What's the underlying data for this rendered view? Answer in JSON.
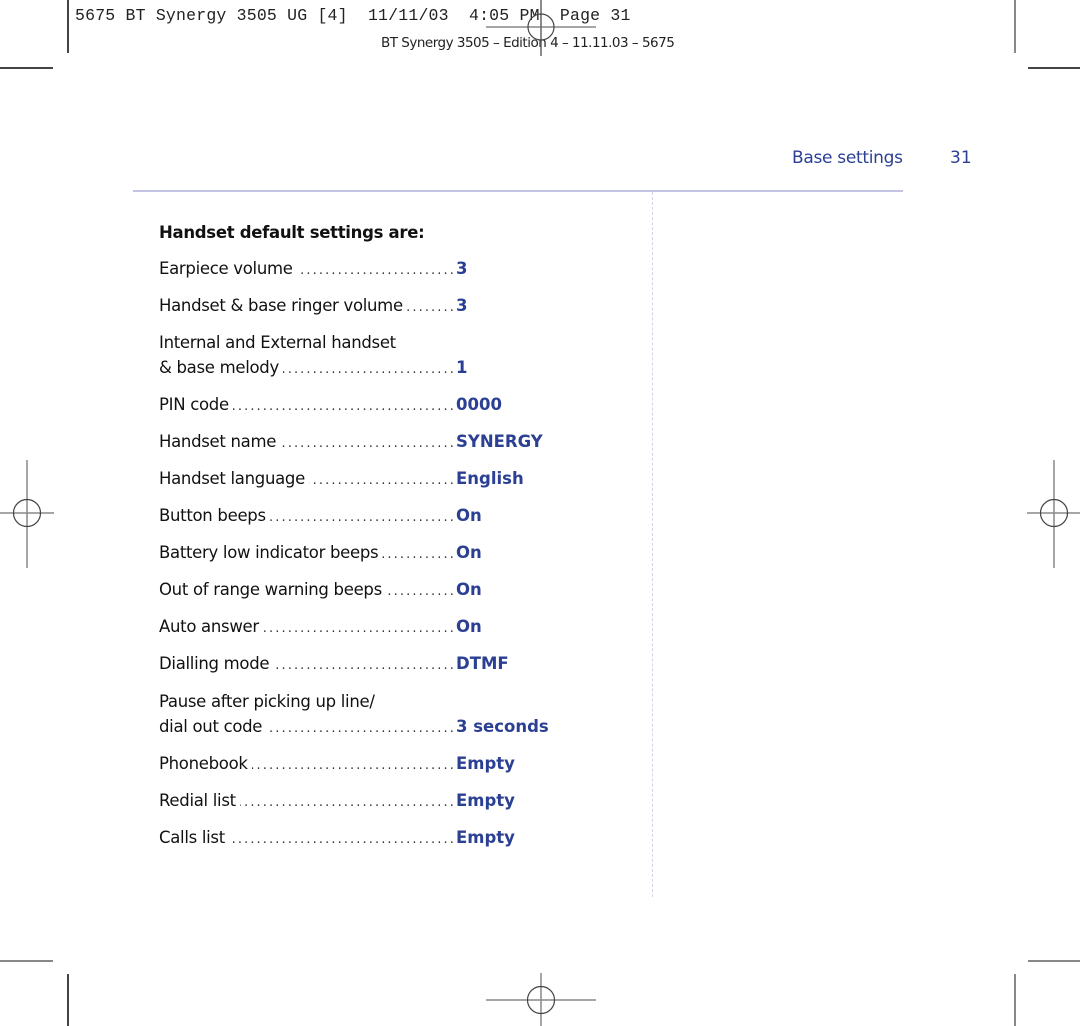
{
  "print_slug": "5675 BT Synergy 3505 UG [4]  11/11/03  4:05 PM  Page 31",
  "edition_line": "BT Synergy 3505 – Edition 4 – 11.11.03 – 5675",
  "header": {
    "section_title": "Base settings",
    "page_number": "31"
  },
  "colors": {
    "accent": "#2b3f93",
    "rule": "#c3c3e3",
    "text": "#111111"
  },
  "content": {
    "heading": "Handset default settings are:",
    "settings": [
      {
        "label": "Earpiece volume",
        "value": "3"
      },
      {
        "label": "Handset & base ringer volume",
        "value": "3"
      },
      {
        "label_line1": "Internal and External handset",
        "label": "& base melody",
        "value": "1"
      },
      {
        "label": "PIN code",
        "value": "0000"
      },
      {
        "label": "Handset name",
        "value": "SYNERGY"
      },
      {
        "label": "Handset language",
        "value": "English"
      },
      {
        "label": "Button beeps",
        "value": "On"
      },
      {
        "label": "Battery low indicator beeps",
        "value": "On"
      },
      {
        "label": "Out of range warning beeps",
        "value": "On"
      },
      {
        "label": "Auto answer",
        "value": "On"
      },
      {
        "label": "Dialling mode",
        "value": "DTMF"
      },
      {
        "label_line1": "Pause after picking up line/",
        "label": "dial out code",
        "value": "3 seconds"
      },
      {
        "label": "Phonebook",
        "value": "Empty"
      },
      {
        "label": "Redial list",
        "value": "Empty"
      },
      {
        "label": "Calls list",
        "value": "Empty"
      }
    ]
  },
  "icons": {
    "registration_mark": "crosshair-circle",
    "crop_mark": "corner-crop-line"
  }
}
